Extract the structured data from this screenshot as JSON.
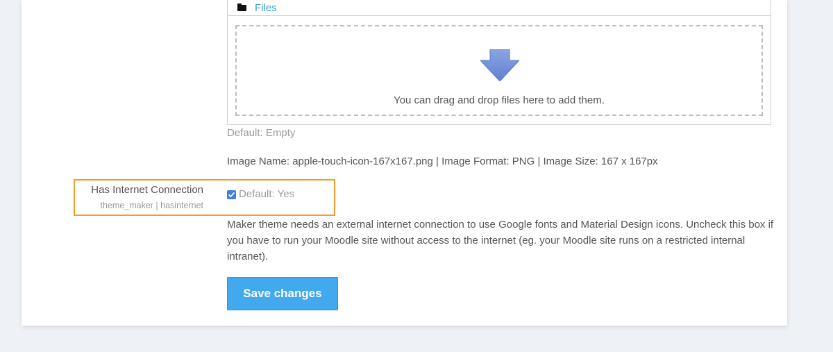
{
  "filepicker": {
    "folder_icon": "folder-icon",
    "files_link": "Files",
    "arrow_icon": "download-arrow-icon",
    "drop_text": "You can drag and drop files here to add them."
  },
  "default_empty": "Default: Empty",
  "image_info": "Image Name: apple-touch-icon-167x167.png | Image Format: PNG | Image Size: 167 x 167px",
  "setting": {
    "label": "Has Internet Connection",
    "sub_label": "theme_maker | hasinternet",
    "checked": true,
    "default_text": "Default: Yes",
    "description": "Maker theme needs an external internet connection to use Google fonts and Material Design icons. Uncheck this box if you have to run your Moodle site without access to the internet (eg. your Moodle site runs on a restricted internal intranet)."
  },
  "save_button": "Save changes",
  "colors": {
    "accent": "#42a9ef",
    "link": "#3ea0e4",
    "highlight": "#f39a2b",
    "checkbox": "#3f7fd8",
    "background": "#eef1f6"
  }
}
